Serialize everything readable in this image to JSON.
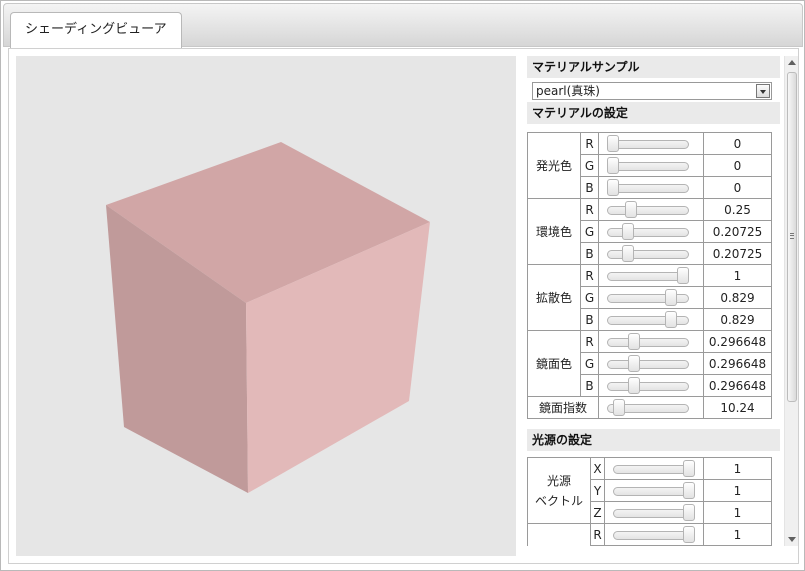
{
  "tab": {
    "label": "シェーディングビューア"
  },
  "material_sample": {
    "heading": "マテリアルサンプル",
    "selected": "pearl(真珠)"
  },
  "material_settings": {
    "heading": "マテリアルの設定",
    "groups": [
      {
        "label": "発光色",
        "rows": [
          {
            "channel": "R",
            "value": "0",
            "fraction": 0
          },
          {
            "channel": "G",
            "value": "0",
            "fraction": 0
          },
          {
            "channel": "B",
            "value": "0",
            "fraction": 0
          }
        ]
      },
      {
        "label": "環境色",
        "rows": [
          {
            "channel": "R",
            "value": "0.25",
            "fraction": 0.25
          },
          {
            "channel": "G",
            "value": "0.20725",
            "fraction": 0.20725
          },
          {
            "channel": "B",
            "value": "0.20725",
            "fraction": 0.20725
          }
        ]
      },
      {
        "label": "拡散色",
        "rows": [
          {
            "channel": "R",
            "value": "1",
            "fraction": 1
          },
          {
            "channel": "G",
            "value": "0.829",
            "fraction": 0.829
          },
          {
            "channel": "B",
            "value": "0.829",
            "fraction": 0.829
          }
        ]
      },
      {
        "label": "鏡面色",
        "rows": [
          {
            "channel": "R",
            "value": "0.296648",
            "fraction": 0.296648
          },
          {
            "channel": "G",
            "value": "0.296648",
            "fraction": 0.296648
          },
          {
            "channel": "B",
            "value": "0.296648",
            "fraction": 0.296648
          }
        ]
      }
    ],
    "shininess": {
      "label": "鏡面指数",
      "value": "10.24",
      "fraction": 0.08
    }
  },
  "light_settings": {
    "heading": "光源の設定",
    "vector": {
      "label_line1": "光源",
      "label_line2": "ベクトル",
      "rows": [
        {
          "channel": "X",
          "value": "1",
          "fraction": 1
        },
        {
          "channel": "Y",
          "value": "1",
          "fraction": 1
        },
        {
          "channel": "Z",
          "value": "1",
          "fraction": 1
        }
      ]
    },
    "color": {
      "rows": [
        {
          "channel": "R",
          "value": "1",
          "fraction": 1
        }
      ]
    }
  },
  "cube_colors": {
    "top": "#d1a6a6",
    "left": "#c09a9a",
    "right": "#e2b9b9",
    "background": "#e6e6e6"
  }
}
